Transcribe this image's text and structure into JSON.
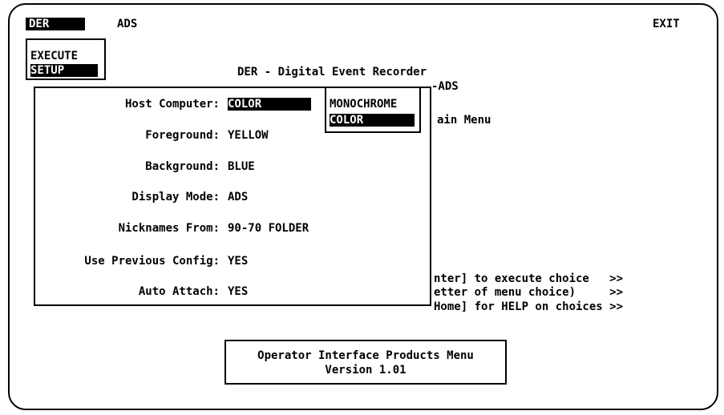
{
  "menubar": {
    "item_active": "DER",
    "item_ads": "ADS",
    "item_exit": "EXIT"
  },
  "execute_menu": {
    "execute": "EXECUTE",
    "setup": "SETUP"
  },
  "title": "DER - Digital Event Recorder",
  "background_text": {
    "ads_suffix": "-ADS",
    "main_menu": "ain Menu",
    "hint1": "nter] to execute choice   >>",
    "hint2": "etter of menu choice)     >>",
    "hint3": "Home] for HELP on choices >>"
  },
  "setup_dialog": {
    "fields": [
      {
        "label": "Host Computer:",
        "value": "COLOR"
      },
      {
        "label": "Foreground:",
        "value": "YELLOW"
      },
      {
        "label": "Background:",
        "value": "BLUE"
      },
      {
        "label": "Display Mode:",
        "value": "ADS"
      },
      {
        "label": "Nicknames From:",
        "value": "90-70 FOLDER"
      },
      {
        "label": "Use Previous Config:",
        "value": "YES"
      },
      {
        "label": "Auto Attach:",
        "value": "YES"
      }
    ]
  },
  "host_dropdown": {
    "options": [
      "MONOCHROME",
      "COLOR"
    ],
    "selected": "COLOR"
  },
  "footer": {
    "line1": "Operator Interface Products Menu",
    "line2": "Version 1.01"
  }
}
